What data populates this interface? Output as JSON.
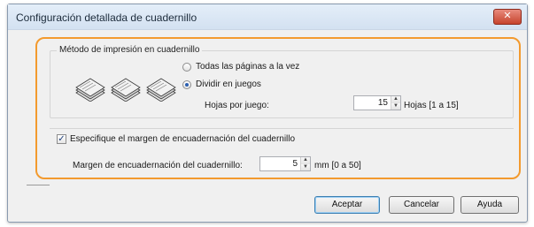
{
  "window": {
    "title": "Configuración detallada de cuadernillo",
    "close_glyph": "✕"
  },
  "group": {
    "label": "Método de impresión en cuadernillo",
    "options": [
      {
        "label": "Todas las páginas a la vez",
        "selected": false
      },
      {
        "label": "Dividir en juegos",
        "selected": true
      }
    ],
    "pages_per_set_label": "Hojas por juego:",
    "pages_per_set_value": "15",
    "pages_per_set_unit": "Hojas [1 a 15]"
  },
  "gutter": {
    "checkbox_label": "Especifique el margen de encuadernación del cuadernillo",
    "checked": true,
    "check_glyph": "✓",
    "margin_label": "Margen de encuadernación del cuadernillo:",
    "margin_value": "5",
    "margin_unit": "mm [0 a 50]"
  },
  "buttons": {
    "ok": "Aceptar",
    "cancel": "Cancelar",
    "help": "Ayuda"
  },
  "icons": {
    "spin_up": "▲",
    "spin_down": "▼",
    "booklet": "booklet-icon"
  },
  "colors": {
    "highlight": "#f39a2e",
    "close_button": "#c7442e"
  }
}
